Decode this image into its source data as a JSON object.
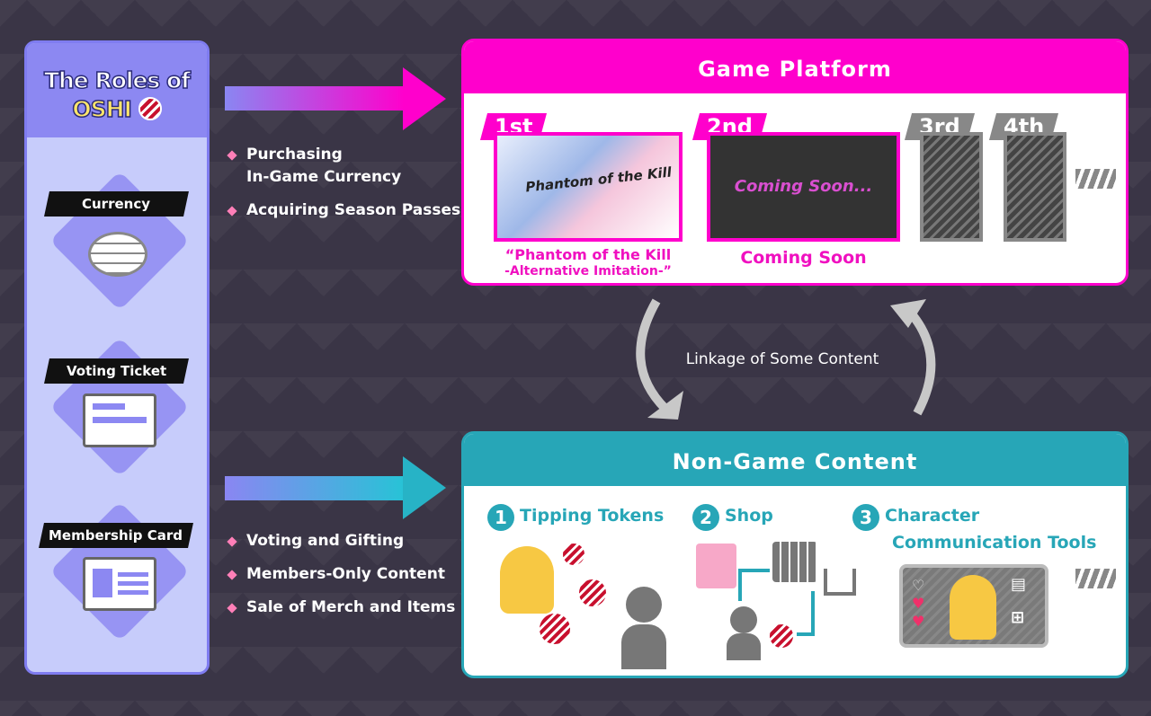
{
  "left_panel": {
    "title_line1": "The Roles of",
    "title_line2": "OSHI",
    "roles": [
      {
        "label": "Currency",
        "icon": "coins-icon"
      },
      {
        "label": "Voting Ticket",
        "icon": "ticket-icon"
      },
      {
        "label": "Membership Card",
        "icon": "id-card-icon"
      }
    ]
  },
  "game_bullets": [
    "Purchasing\nIn-Game Currency",
    "Acquiring Season Passes"
  ],
  "nongame_bullets": [
    "Voting and Gifting",
    "Members-Only Content",
    "Sale of Merch and Items"
  ],
  "game_platform": {
    "title": "Game Platform",
    "color": "#ff00cc",
    "slots": [
      {
        "rank": "1st",
        "caption_line1": "“Phantom of the Kill",
        "caption_line2": "-Alternative Imitation-”",
        "logo": "Phantom of the Kill"
      },
      {
        "rank": "2nd",
        "screen_text": "Coming Soon...",
        "caption_line1": "Coming Soon"
      },
      {
        "rank": "3rd"
      },
      {
        "rank": "4th"
      }
    ]
  },
  "linkage": "Linkage of Some Content",
  "non_game": {
    "title": "Non-Game Content",
    "color": "#27a6b7",
    "items": [
      {
        "num": "1",
        "label": "Tipping Tokens"
      },
      {
        "num": "2",
        "label": "Shop"
      },
      {
        "num": "3",
        "label_line1": "Character",
        "label_line2": "Communication Tools"
      }
    ]
  }
}
